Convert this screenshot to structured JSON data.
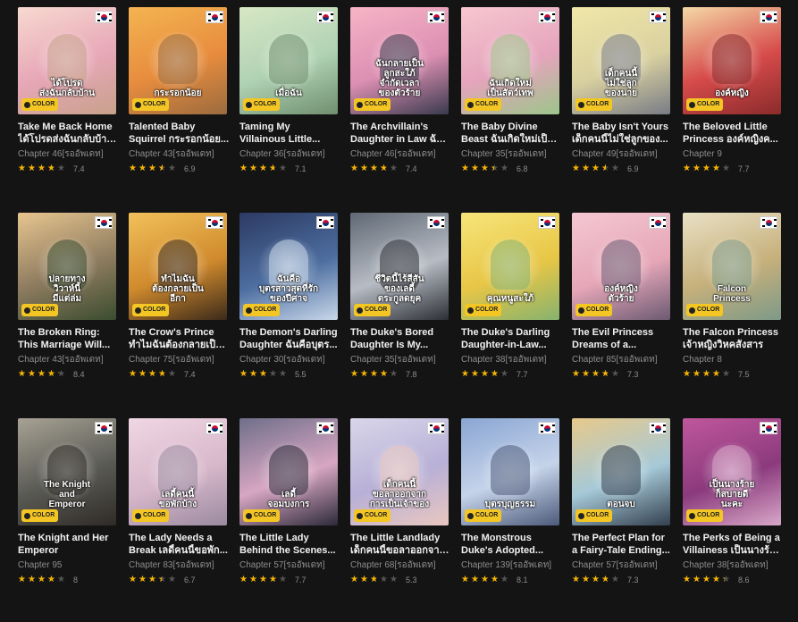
{
  "badge_label": "COLOR",
  "flag_icon": "korea-flag-icon",
  "cards": [
    {
      "title1": "Take Me Back Home",
      "title2": "ได้โปรดส่งฉันกลับบ้าน...",
      "chapter": "Chapter 46[รออัพเดท]",
      "rating": 3.7,
      "score": "7.4",
      "cover_text": "ได้โปรด\nส่งฉันกลับบ้าน",
      "colors": [
        "#f7d9d0",
        "#e7a7b7",
        "#c7a18b"
      ]
    },
    {
      "title1": "Talented Baby",
      "title2": "Squirrel กระรอกน้อย...",
      "chapter": "Chapter 43[รออัพเดท]",
      "rating": 3.45,
      "score": "6.9",
      "cover_text": "กระรอกน้อย",
      "colors": [
        "#f4b451",
        "#e78c3e",
        "#9b6b3e"
      ]
    },
    {
      "title1": "Taming My",
      "title2": "Villainous Little...",
      "chapter": "Chapter 36[รออัพเดท]",
      "rating": 3.55,
      "score": "7.1",
      "cover_text": "เมื่อฉัน",
      "colors": [
        "#d7e7c4",
        "#b0d2b4",
        "#6f8f6e"
      ]
    },
    {
      "title1": "The Archvillain's",
      "title2": "Daughter in Law ฉัน...",
      "chapter": "Chapter 46[รออัพเดท]",
      "rating": 3.7,
      "score": "7.4",
      "cover_text": "ฉันกลายเป็น\nลูกสะใภ้\nจำกัดเวลา\nของตัวร้าย",
      "colors": [
        "#f7b4c6",
        "#dc8fb2",
        "#3a3a4e"
      ]
    },
    {
      "title1": "The Baby Divine",
      "title2": "Beast ฉันเกิดใหม่เป็น...",
      "chapter": "Chapter 35[รออัพเดท]",
      "rating": 3.4,
      "score": "6.8",
      "cover_text": "ฉันเกิดใหม่\nเป็นสัตว์เทพ",
      "colors": [
        "#f7c7d1",
        "#e5a4bc",
        "#9cc58a"
      ]
    },
    {
      "title1": "The Baby Isn't Yours",
      "title2": "เด็กคนนี้ไม่ใช่ลูกของ...",
      "chapter": "Chapter 49[รออัพเดท]",
      "rating": 3.45,
      "score": "6.9",
      "cover_text": "เด็กคนนี้\nไม่ใช่ลูก\nของนาย",
      "colors": [
        "#f0e7a8",
        "#d9d0a0",
        "#787c86"
      ]
    },
    {
      "title1": "The Beloved Little",
      "title2": "Princess องค์หญิงค...",
      "chapter": "Chapter 9",
      "rating": 3.85,
      "score": "7.7",
      "cover_text": "องค์หญิง",
      "colors": [
        "#f5d8a6",
        "#d64a4a",
        "#8b2b2b"
      ]
    },
    {
      "title1": "The Broken Ring:",
      "title2": "This Marriage Will...",
      "chapter": "Chapter 43[รออัพเดท]",
      "rating": 4.2,
      "score": "8.4",
      "cover_text": "ปลายทาง\nวิวาห์นี้\nมีแต่ล่ม",
      "colors": [
        "#e7c58f",
        "#8d7b5f",
        "#3b4c2f"
      ]
    },
    {
      "title1": "The Crow's Prince",
      "title2": "ทำไมฉันต้องกลายเป็น...",
      "chapter": "Chapter 75[รออัพเดท]",
      "rating": 3.7,
      "score": "7.4",
      "cover_text": "ทำไมฉัน\nต้องกลายเป็น\nอีกา",
      "colors": [
        "#f2c15b",
        "#d08a2d",
        "#3b2a1a"
      ]
    },
    {
      "title1": "The Demon's Darling",
      "title2": "Daughter ฉันคือบุตร...",
      "chapter": "Chapter 30[รออัพเดท]",
      "rating": 2.75,
      "score": "5.5",
      "cover_text": "ฉันคือ\nบุตรสาวสุดที่รัก\nของปีศาจ",
      "colors": [
        "#2c3a63",
        "#4d6ea0",
        "#c9d8ea"
      ]
    },
    {
      "title1": "The Duke's Bored",
      "title2": "Daughter Is My...",
      "chapter": "Chapter 35[รออัพเดท]",
      "rating": 3.9,
      "score": "7.8",
      "cover_text": "ชีวิตนี้ไร้สีสัน\nของเลดี้\nตระกูลดยุค",
      "colors": [
        "#5f6874",
        "#b7bcc4",
        "#2d2f36"
      ]
    },
    {
      "title1": "The Duke's Darling",
      "title2": "Daughter-in-Law...",
      "chapter": "Chapter 38[รออัพเดท]",
      "rating": 3.85,
      "score": "7.7",
      "cover_text": "คุณหนูสะใภ้",
      "colors": [
        "#f7e57a",
        "#e8c646",
        "#86b36e"
      ]
    },
    {
      "title1": "The Evil Princess",
      "title2": "Dreams of a...",
      "chapter": "Chapter 85[รออัพเดท]",
      "rating": 3.65,
      "score": "7.3",
      "cover_text": "องค์หญิง\nตัวร้าย",
      "colors": [
        "#f4c7d2",
        "#e6a7b8",
        "#6c5a73"
      ]
    },
    {
      "title1": "The Falcon Princess",
      "title2": "เจ้าหญิงวิหคสังสาร",
      "chapter": "Chapter 8",
      "rating": 3.75,
      "score": "7.5",
      "cover_text": "Falcon\nPrincess",
      "colors": [
        "#e9e1c5",
        "#c6b07b",
        "#7d9a88"
      ]
    },
    {
      "title1": "The Knight and Her",
      "title2": "Emperor",
      "chapter": "Chapter 95",
      "rating": 4.0,
      "score": "8",
      "cover_text": "The Knight\nand\nEmperor",
      "colors": [
        "#a7a294",
        "#5a5a55",
        "#2f2b26"
      ]
    },
    {
      "title1": "The Lady Needs a",
      "title2": "Break เลดี้คนนี้ขอพัก...",
      "chapter": "Chapter 83[รออัพเดท]",
      "rating": 3.35,
      "score": "6.7",
      "cover_text": "เลดี้คนนี้\nขอพักบ้าง",
      "colors": [
        "#f0d7e3",
        "#d7b7ca",
        "#9a8aa0"
      ]
    },
    {
      "title1": "The Little Lady",
      "title2": "Behind the Scenes...",
      "chapter": "Chapter 57[รออัพเดท]",
      "rating": 3.85,
      "score": "7.7",
      "cover_text": "เลดี้\nจอมบงการ",
      "colors": [
        "#6f6f8a",
        "#d7a6c2",
        "#2d2a3a"
      ]
    },
    {
      "title1": "The Little Landlady",
      "title2": "เด็กคนนี้ขอลาออกจาก...",
      "chapter": "Chapter 68[รออัพเดท]",
      "rating": 2.65,
      "score": "5.3",
      "cover_text": "เด็กคนนี้\nขอลาออกจาก\nการเป็นเจ้าของ",
      "colors": [
        "#d8d6ea",
        "#b8b0d6",
        "#e9c7c0"
      ]
    },
    {
      "title1": "The Monstrous",
      "title2": "Duke's Adopted...",
      "chapter": "Chapter 139[รออัพเดท]",
      "rating": 4.05,
      "score": "8.1",
      "cover_text": "บุตรบุญธรรม",
      "colors": [
        "#8aa6d3",
        "#c5d3ea",
        "#4d5a7a"
      ]
    },
    {
      "title1": "The Perfect Plan for",
      "title2": "a Fairy-Tale Ending...",
      "chapter": "Chapter 57[รออัพเดท]",
      "rating": 3.65,
      "score": "7.3",
      "cover_text": "ตอนจบ",
      "colors": [
        "#e7c98a",
        "#a6c9d8",
        "#33404f"
      ]
    },
    {
      "title1": "The Perks of Being a",
      "title2": "Villainess เป็นนางร้า...",
      "chapter": "Chapter 38[รออัพเดท]",
      "rating": 4.3,
      "score": "8.6",
      "cover_text": "เป็นนางร้าย\nก็สบายดี\nนะคะ",
      "colors": [
        "#c0579c",
        "#8b3a7d",
        "#d8a8c8"
      ]
    }
  ]
}
